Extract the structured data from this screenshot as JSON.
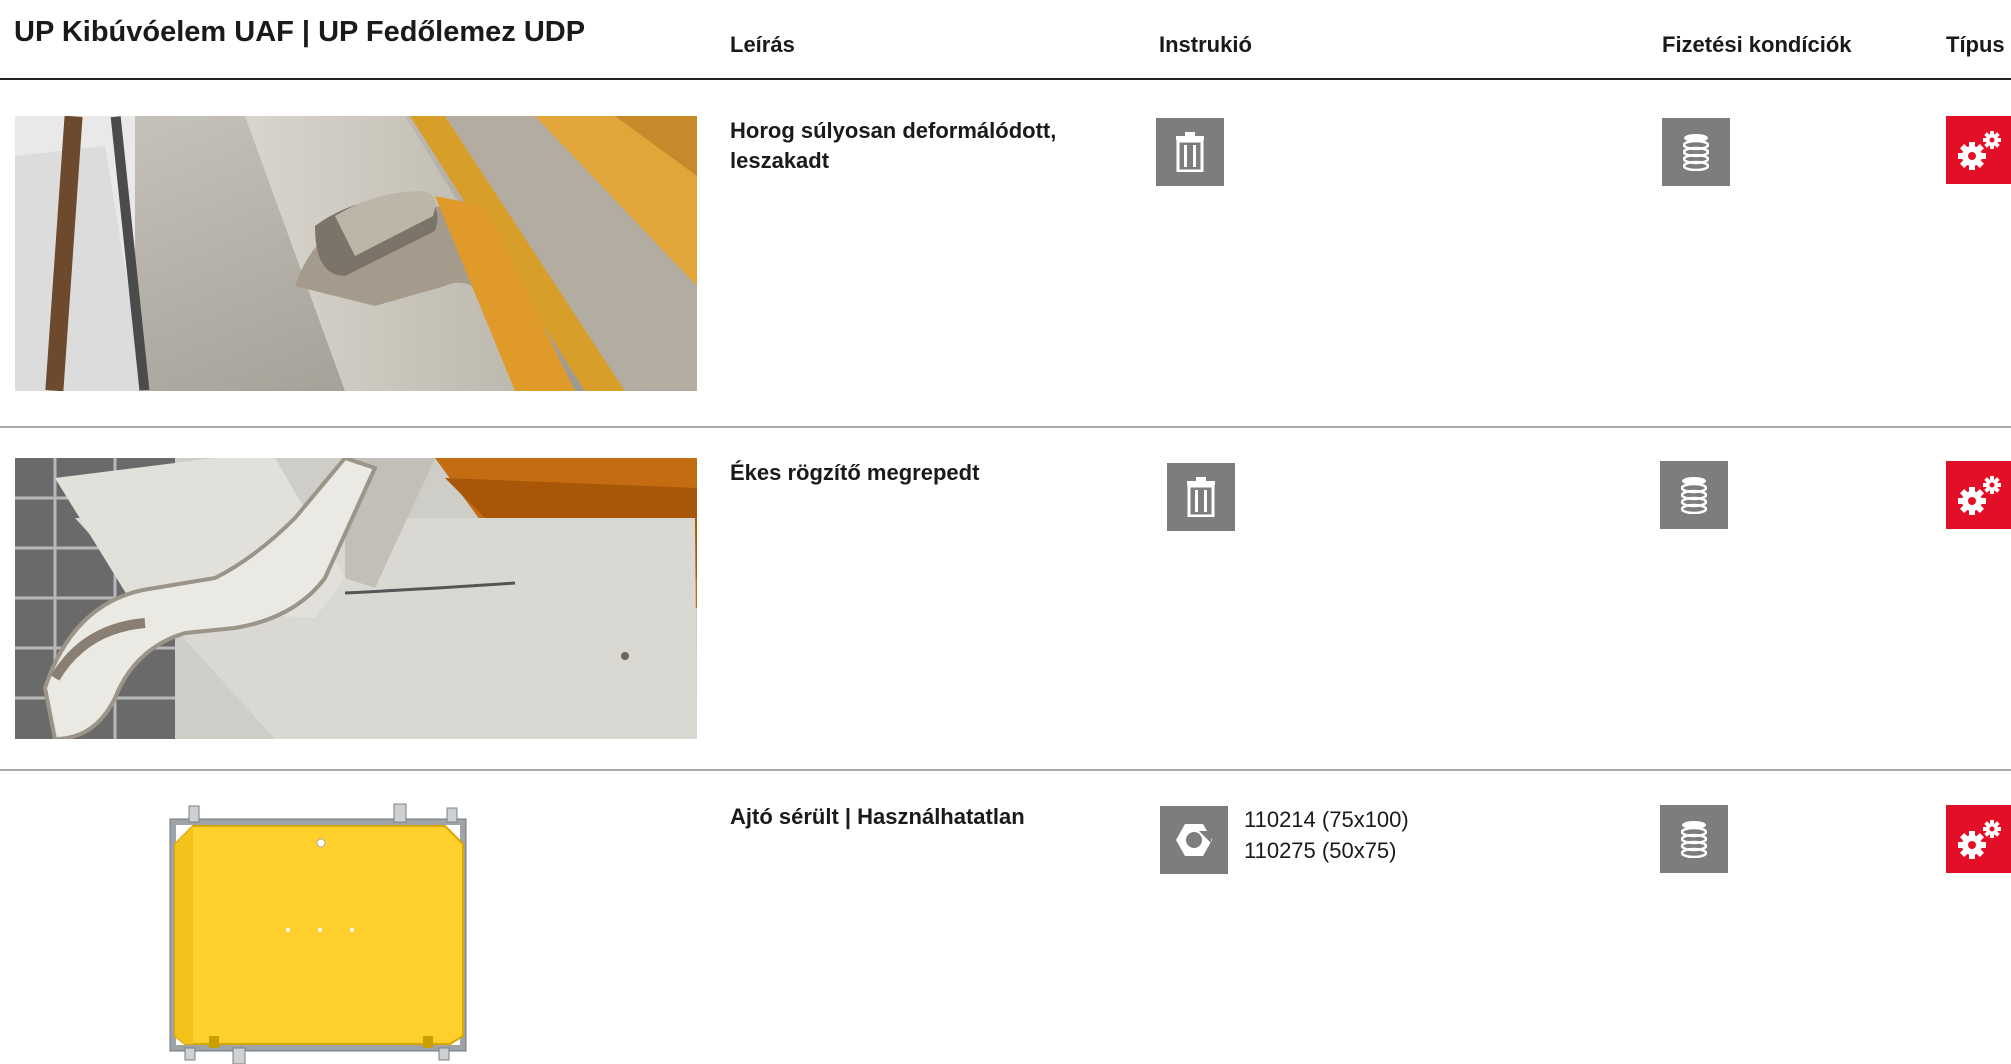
{
  "header": {
    "title": "UP Kibúvóelem  UAF | UP Fedőlemez UDP",
    "col_description": "Leírás",
    "col_instruction": "Instrukió",
    "col_payment": "Fizetési kondíciók",
    "col_type": "Típus"
  },
  "rows": [
    {
      "description": "Horog súlyosan deformálódott, leszakadt",
      "instruction_icon": "trash-icon",
      "payment_icon": "coin-stack-icon",
      "type_icon": "gears-icon",
      "photo": "hook-deformed-photo"
    },
    {
      "description": "Ékes rögzítő megrepedt",
      "instruction_icon": "trash-icon",
      "payment_icon": "coin-stack-icon",
      "type_icon": "gears-icon",
      "photo": "wedge-cracked-photo"
    },
    {
      "description": "Ajtó sérült | Használhatatlan",
      "instruction_icon": "hex-nut-icon",
      "codes": [
        "110214 (75x100)",
        "110275 (50x75)"
      ],
      "payment_icon": "coin-stack-icon",
      "type_icon": "gears-icon",
      "photo": "door-panel-drawing"
    }
  ],
  "colors": {
    "icon_gray": "#7d7d7d",
    "type_red": "#e30f27",
    "door_yellow": "#ffd02b",
    "divider": "#a8a8a8"
  }
}
